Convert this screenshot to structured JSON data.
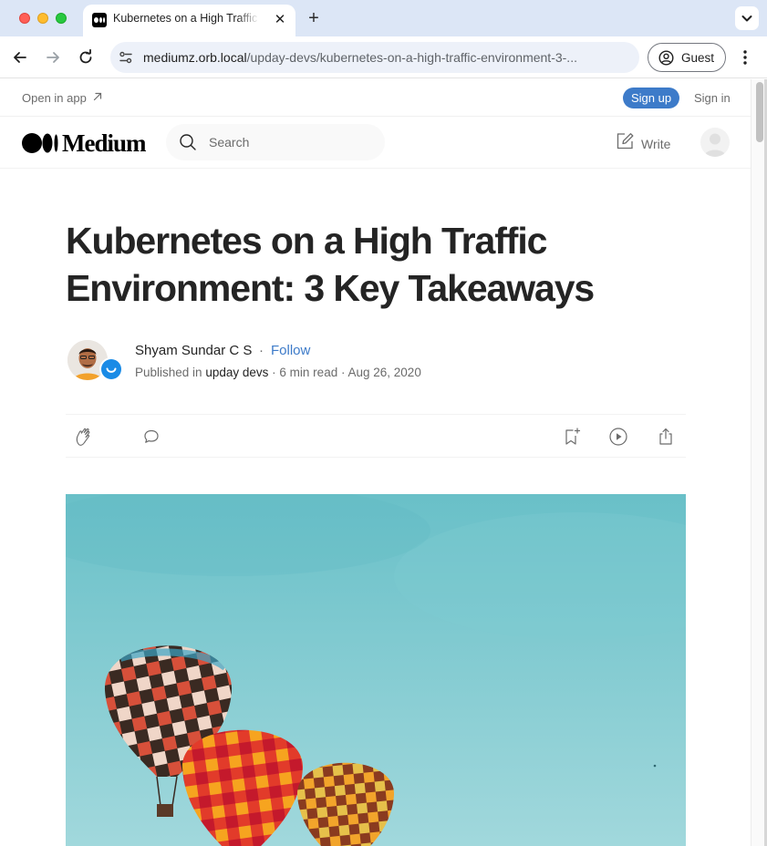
{
  "browser": {
    "tab_title": "Kubernetes on a High Traffic Environment: 3 Key Takeaways",
    "new_tab_symbol": "+",
    "close_symbol": "✕",
    "url_host": "mediumz.orb.local",
    "url_path": "/upday-devs/kubernetes-on-a-high-traffic-environment-3-...",
    "profile_label": "Guest"
  },
  "banner": {
    "open_in_app": "Open in app",
    "sign_up": "Sign up",
    "sign_in": "Sign in"
  },
  "nav": {
    "logo_text": "Medium",
    "search_placeholder": "Search",
    "write_label": "Write"
  },
  "article": {
    "title": "Kubernetes on a High Traffic Environment: 3 Key Takeaways",
    "author": "Shyam Sundar C S",
    "follow_label": "Follow",
    "separator": "·",
    "published_prefix": "Published in",
    "publication": "upday devs",
    "read_time": "6 min read",
    "date": "Aug 26, 2020"
  },
  "colors": {
    "accent_blue": "#3d7bc9",
    "sky_top": "#6ec3cc",
    "sky_bottom": "#9fd6db"
  }
}
